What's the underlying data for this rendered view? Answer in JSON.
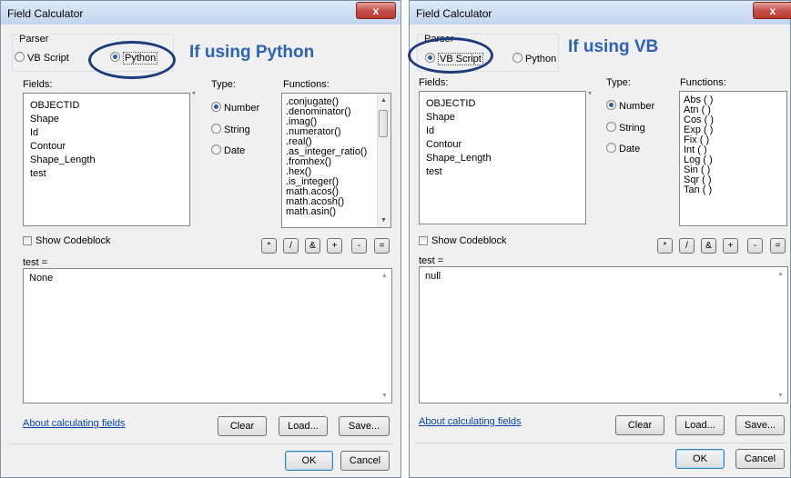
{
  "left": {
    "title": "Field Calculator",
    "close_glyph": "x",
    "parser_label": "Parser",
    "parser_options": [
      "VB Script",
      "Python"
    ],
    "selected_parser": "Python",
    "annotation": "If using Python",
    "fields_label": "Fields:",
    "fields": [
      "OBJECTID",
      "Shape",
      "Id",
      "Contour",
      "Shape_Length",
      "test"
    ],
    "type_label": "Type:",
    "types": [
      "Number",
      "String",
      "Date"
    ],
    "selected_type": "Number",
    "functions_label": "Functions:",
    "functions": [
      ".conjugate()",
      ".denominator()",
      ".imag()",
      ".numerator()",
      ".real()",
      ".as_integer_ratio()",
      ".fromhex()",
      ".hex()",
      ".is_integer()",
      "math.acos()",
      "math.acosh()",
      "math.asin()"
    ],
    "show_codeblock": "Show Codeblock",
    "operators": [
      "*",
      "/",
      "&",
      "+",
      "-",
      "="
    ],
    "expression_label": "test =",
    "expression": "None",
    "about_link": "About calculating fields",
    "clear": "Clear",
    "load": "Load...",
    "save": "Save...",
    "ok": "OK",
    "cancel": "Cancel"
  },
  "right": {
    "title": "Field Calculator",
    "close_glyph": "x",
    "parser_label": "Parser",
    "parser_options": [
      "VB Script",
      "Python"
    ],
    "selected_parser": "VB Script",
    "annotation": "If using VB",
    "fields_label": "Fields:",
    "fields": [
      "OBJECTID",
      "Shape",
      "Id",
      "Contour",
      "Shape_Length",
      "test"
    ],
    "type_label": "Type:",
    "types": [
      "Number",
      "String",
      "Date"
    ],
    "selected_type": "Number",
    "functions_label": "Functions:",
    "functions": [
      "Abs ( )",
      "Atn ( )",
      "Cos ( )",
      "Exp ( )",
      "Fix ( )",
      "Int ( )",
      "Log ( )",
      "Sin ( )",
      "Sqr ( )",
      "Tan ( )"
    ],
    "show_codeblock": "Show Codeblock",
    "operators": [
      "*",
      "/",
      "&",
      "+",
      "-",
      "="
    ],
    "expression_label": "test =",
    "expression": "null",
    "about_link": "About calculating fields",
    "clear": "Clear",
    "load": "Load...",
    "save": "Save...",
    "ok": "OK",
    "cancel": "Cancel"
  }
}
